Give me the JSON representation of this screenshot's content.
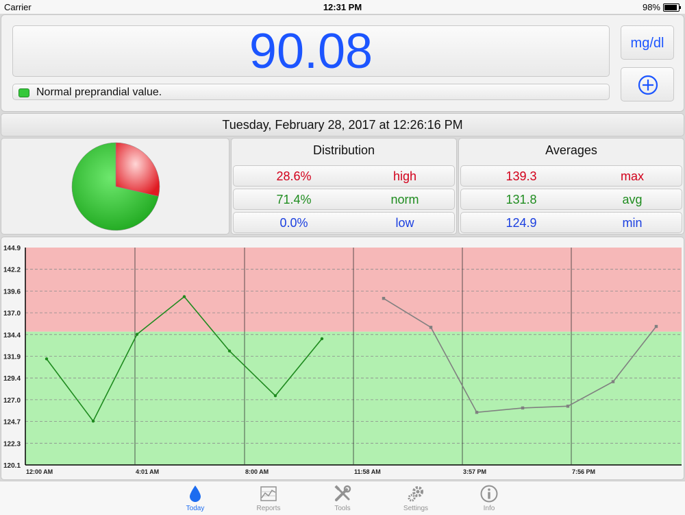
{
  "status_bar": {
    "carrier": "Carrier",
    "time": "12:31 PM",
    "battery": "98%"
  },
  "reading": {
    "value": "90.08",
    "status_text": "Normal preprandial value.",
    "unit_button": "mg/dl"
  },
  "timestamp": "Tuesday, February 28, 2017 at 12:26:16 PM",
  "distribution": {
    "title": "Distribution",
    "rows": [
      {
        "value": "28.6%",
        "label": "high"
      },
      {
        "value": "71.4%",
        "label": "norm"
      },
      {
        "value": "0.0%",
        "label": "low"
      }
    ]
  },
  "averages": {
    "title": "Averages",
    "rows": [
      {
        "value": "139.3",
        "label": "max"
      },
      {
        "value": "131.8",
        "label": "avg"
      },
      {
        "value": "124.9",
        "label": "min"
      }
    ]
  },
  "colors": {
    "accent": "#1c55ff",
    "high": "#d2001b",
    "normal": "#1f8c1f",
    "low": "#1c40e0",
    "high_band": "#f6b8b8",
    "normal_band": "#b2f0b0"
  },
  "chart_data": [
    {
      "type": "pie",
      "labels": [
        "high",
        "norm",
        "low"
      ],
      "values": [
        28.6,
        71.4,
        0.0
      ],
      "colors": [
        "#e8202a",
        "#2fbf2f",
        "#1c40e0"
      ]
    },
    {
      "type": "line",
      "x_ticks": [
        "12:00 AM",
        "4:01 AM",
        "8:00 AM",
        "11:58 AM",
        "3:57 PM",
        "7:56 PM"
      ],
      "y_ticks": [
        "144.9",
        "142.2",
        "139.6",
        "137.0",
        "134.4",
        "131.9",
        "129.4",
        "127.0",
        "124.7",
        "122.3",
        "120.1"
      ],
      "ylim": [
        120.1,
        144.9
      ],
      "xlim_hours": [
        0,
        22
      ],
      "high_threshold": 135.3,
      "grid": true,
      "series": [
        {
          "color": "#1e8a1e",
          "points": [
            [
              0.7,
              132.2
            ],
            [
              2.5,
              125.1
            ],
            [
              4.2,
              135.0
            ],
            [
              6.0,
              139.3
            ],
            [
              7.8,
              133.1
            ],
            [
              9.6,
              128.0
            ],
            [
              11.5,
              134.5
            ]
          ]
        },
        {
          "color": "#808080",
          "points": [
            [
              14.1,
              139.1
            ],
            [
              15.9,
              135.8
            ],
            [
              17.7,
              126.1
            ],
            [
              19.5,
              126.6
            ],
            [
              21.3,
              126.8
            ],
            [
              23.1,
              129.6
            ],
            [
              24.9,
              135.9
            ]
          ]
        }
      ]
    }
  ],
  "tabs": [
    {
      "label": "Today",
      "icon": "drop-icon"
    },
    {
      "label": "Reports",
      "icon": "chart-icon"
    },
    {
      "label": "Tools",
      "icon": "tools-icon"
    },
    {
      "label": "Settings",
      "icon": "gear-icon"
    },
    {
      "label": "Info",
      "icon": "info-icon"
    }
  ]
}
